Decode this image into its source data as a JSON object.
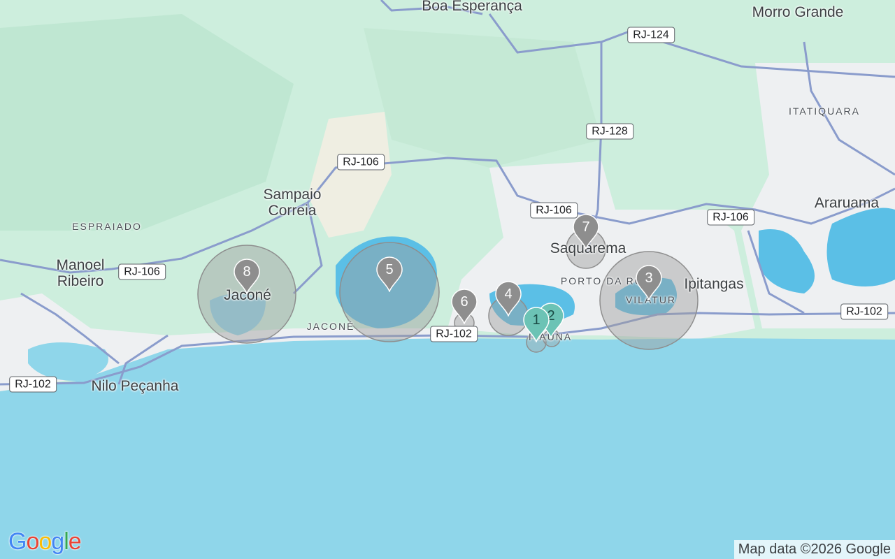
{
  "map": {
    "places": [
      {
        "id": "boa-esperanca",
        "name": "Boa Esperança"
      },
      {
        "id": "morro-grande",
        "name": "Morro Grande"
      },
      {
        "id": "itatiquara",
        "name": "ITATIQUARA"
      },
      {
        "id": "sampaio-correia",
        "name": "Sampaio\nCorreia"
      },
      {
        "id": "araruama",
        "name": "Araruama"
      },
      {
        "id": "espraiado",
        "name": "ESPRAIADO"
      },
      {
        "id": "manoel-ribeiro",
        "name": "Manoel\nRibeiro"
      },
      {
        "id": "jacone-town",
        "name": "Jaconé"
      },
      {
        "id": "saquarema",
        "name": "Saquarema"
      },
      {
        "id": "porto-da-roca",
        "name": "PORTO DA ROÇA"
      },
      {
        "id": "ipitangas",
        "name": "Ipitangas"
      },
      {
        "id": "vilatur",
        "name": "VILATUR"
      },
      {
        "id": "jacone-district",
        "name": "JACONÉ"
      },
      {
        "id": "itauna",
        "name": "ITAÚNA"
      },
      {
        "id": "nilo-pecanha",
        "name": "Nilo Peçanha"
      }
    ],
    "roads": [
      {
        "id": "rj124",
        "label": "RJ-124"
      },
      {
        "id": "rj128",
        "label": "RJ-128"
      },
      {
        "id": "rj106-a",
        "label": "RJ-106"
      },
      {
        "id": "rj106-b",
        "label": "RJ-106"
      },
      {
        "id": "rj106-c",
        "label": "RJ-106"
      },
      {
        "id": "rj106-d",
        "label": "RJ-106"
      },
      {
        "id": "rj102-a",
        "label": "RJ-102"
      },
      {
        "id": "rj102-b",
        "label": "RJ-102"
      },
      {
        "id": "rj102-c",
        "label": "RJ-102"
      }
    ],
    "markers": [
      {
        "id": "m1",
        "label": "1",
        "color": "#6cc3b5"
      },
      {
        "id": "m2",
        "label": "2",
        "color": "#6cc3b5"
      },
      {
        "id": "m3",
        "label": "3",
        "color": "#8e8e8e"
      },
      {
        "id": "m4",
        "label": "4",
        "color": "#8e8e8e"
      },
      {
        "id": "m5",
        "label": "5",
        "color": "#8e8e8e"
      },
      {
        "id": "m6",
        "label": "6",
        "color": "#8e8e8e"
      },
      {
        "id": "m7",
        "label": "7",
        "color": "#8e8e8e"
      },
      {
        "id": "m8",
        "label": "8",
        "color": "#8e8e8e"
      }
    ],
    "colors": {
      "land": "#cdeedd",
      "water": "#8fd6ea",
      "urban": "#eef0f2",
      "lake": "#5bbfe6",
      "road": "#8a9ccc",
      "circle": "#9e9e9e"
    }
  },
  "attribution": "Map data ©2026 Google",
  "logo": {
    "text": "Google",
    "letters": [
      "G",
      "o",
      "o",
      "g",
      "l",
      "e"
    ],
    "colors": [
      "#4285F4",
      "#EA4335",
      "#FBBC05",
      "#4285F4",
      "#34A853",
      "#EA4335"
    ]
  }
}
